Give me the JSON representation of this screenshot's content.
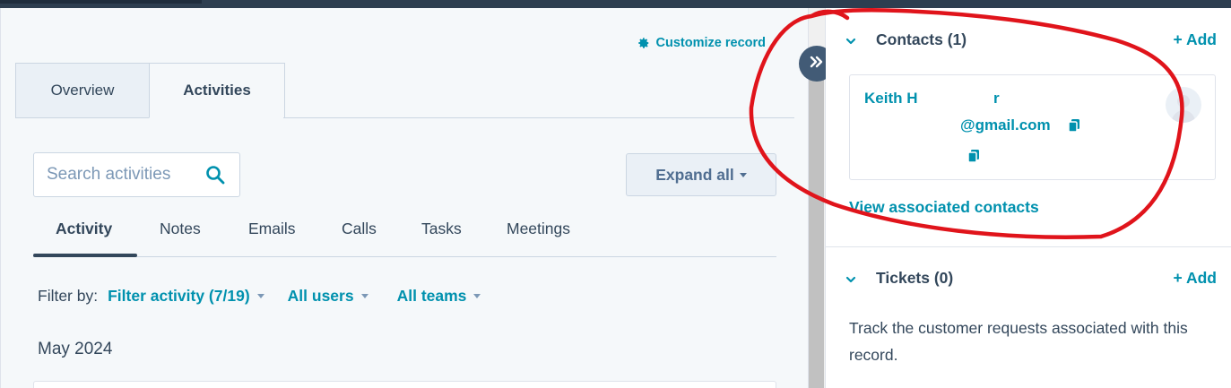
{
  "header": {
    "customize_label": "Customize record"
  },
  "tabs": [
    {
      "label": "Overview",
      "active": false
    },
    {
      "label": "Activities",
      "active": true
    }
  ],
  "search": {
    "placeholder": "Search activities"
  },
  "expand": {
    "label": "Expand all"
  },
  "subtabs": [
    "Activity",
    "Notes",
    "Emails",
    "Calls",
    "Tasks",
    "Meetings"
  ],
  "filters": {
    "label": "Filter by:",
    "activity": "Filter activity (7/19)",
    "users": "All users",
    "teams": "All teams"
  },
  "timeline": {
    "month": "May 2024"
  },
  "sidebar": {
    "contacts": {
      "title": "Contacts (1)",
      "add_label": "+ Add",
      "contact": {
        "name_start": "Keith H",
        "name_end": "r",
        "email": "@gmail.com"
      },
      "view_link": "View associated contacts"
    },
    "tickets": {
      "title": "Tickets (0)",
      "add_label": "+ Add",
      "description": "Track the customer requests associated with this record."
    }
  },
  "colors": {
    "accent": "#0091ae",
    "text": "#33475b",
    "annotation": "#e0141b"
  },
  "icons": [
    "gear-icon",
    "search-icon",
    "caret-down-icon",
    "double-chevron-icon",
    "chevron-down-icon",
    "copy-icon",
    "avatar-icon"
  ]
}
